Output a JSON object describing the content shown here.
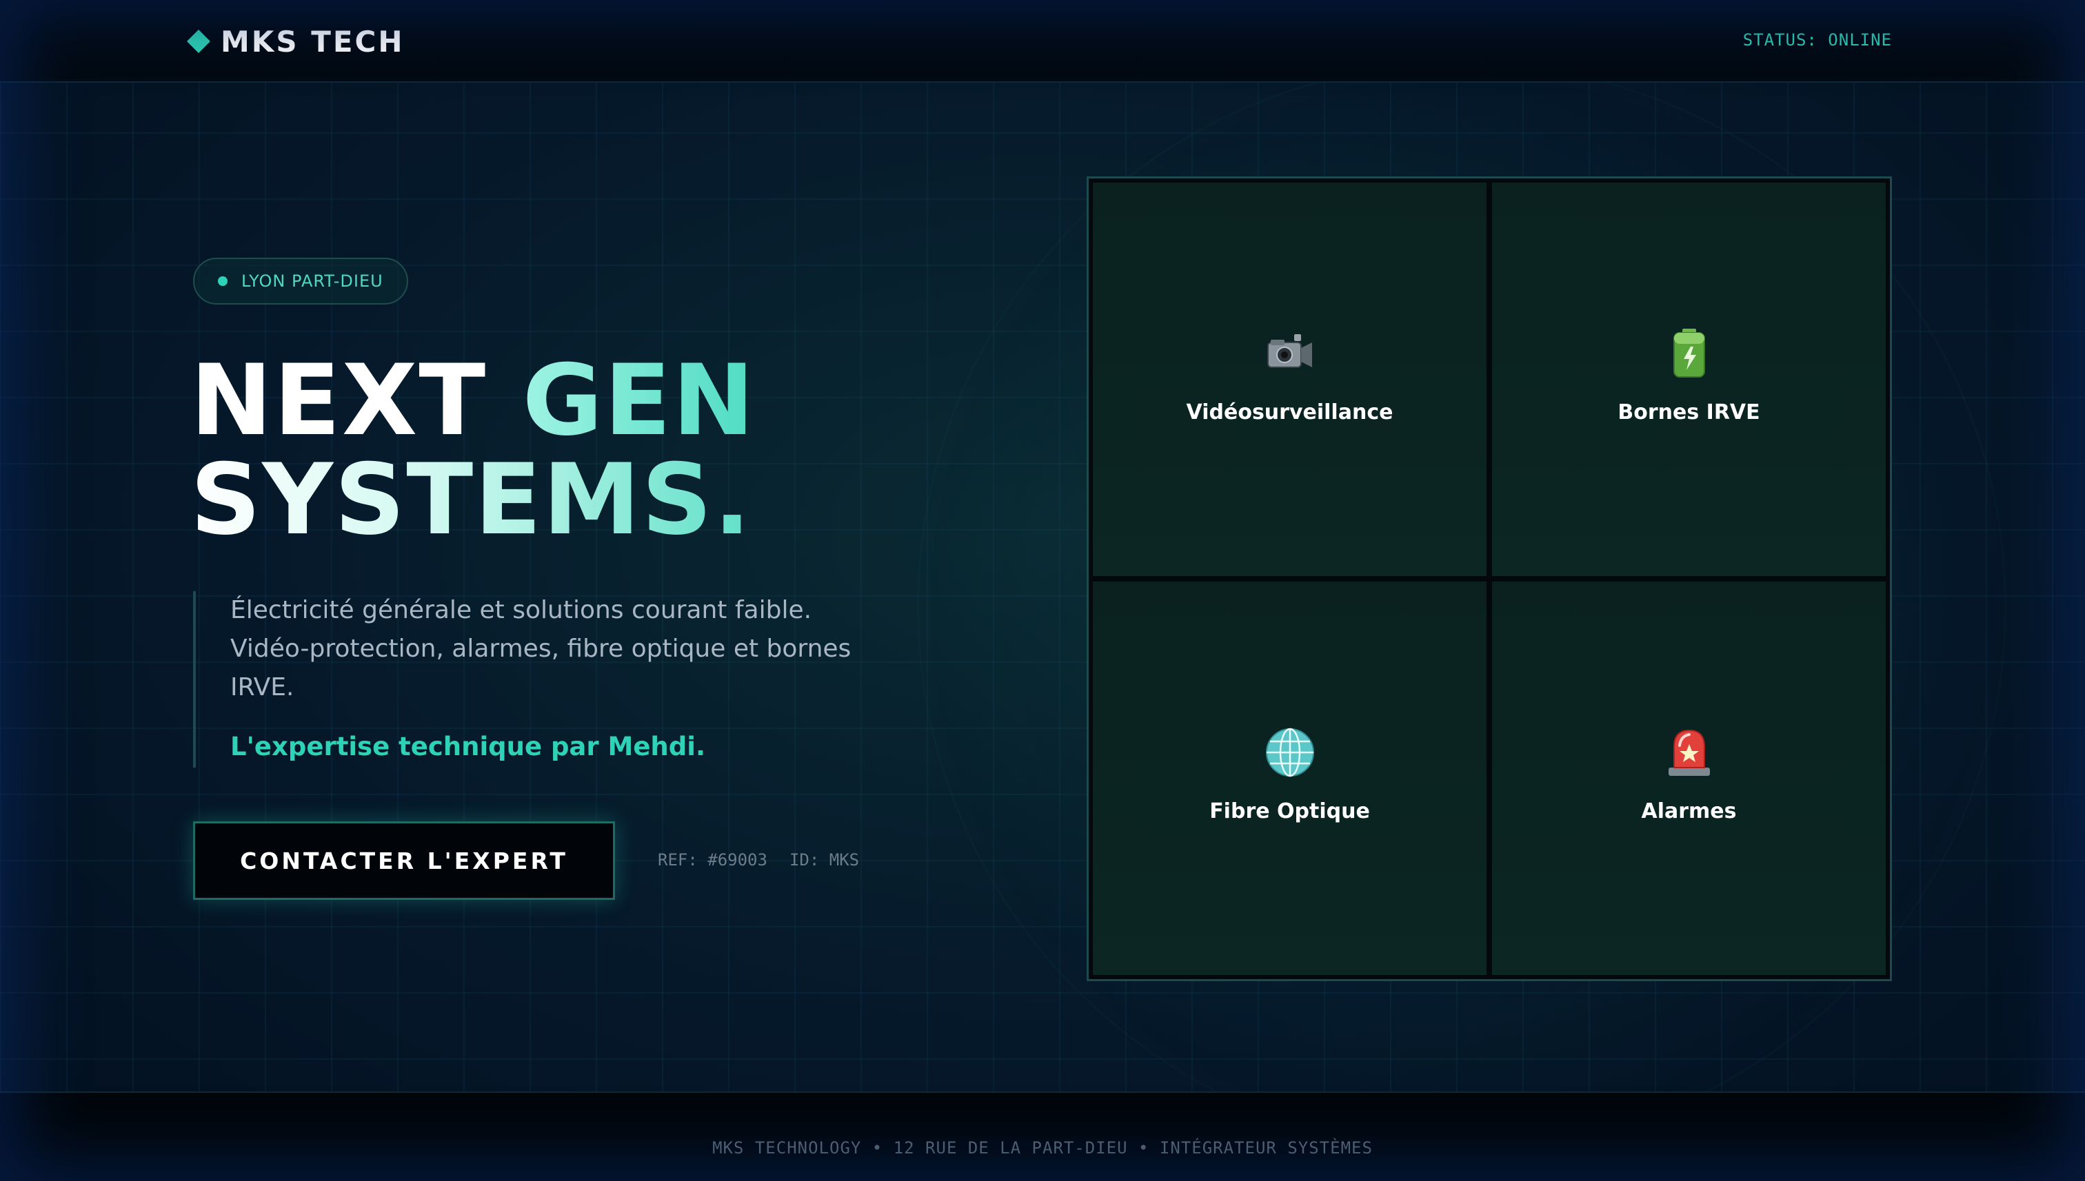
{
  "header": {
    "brand": "MKS TECH",
    "status": "STATUS: ONLINE"
  },
  "hero": {
    "location": "LYON PART-DIEU",
    "title_line1_a": "NEXT ",
    "title_line1_b": "GEN",
    "title_line2": "SYSTEMS.",
    "description": "Électricité générale et solutions courant faible. Vidéo-protection, alarmes, fibre optique et bornes IRVE.",
    "expert_line": "L'expertise technique par Mehdi.",
    "cta_label": "CONTACTER L'EXPERT",
    "ref": "REF: #69003",
    "id": "ID: MKS"
  },
  "services": [
    {
      "label": "Vidéosurveillance",
      "icon": "video-camera-icon"
    },
    {
      "label": "Bornes IRVE",
      "icon": "ev-battery-icon"
    },
    {
      "label": "Fibre Optique",
      "icon": "globe-network-icon"
    },
    {
      "label": "Alarmes",
      "icon": "siren-icon"
    }
  ],
  "colors": {
    "accent": "#2ed3b7",
    "background": "#04111c"
  },
  "footer": {
    "text": "MKS TECHNOLOGY • 12 RUE DE LA PART-DIEU • INTÉGRATEUR SYSTÈMES"
  }
}
